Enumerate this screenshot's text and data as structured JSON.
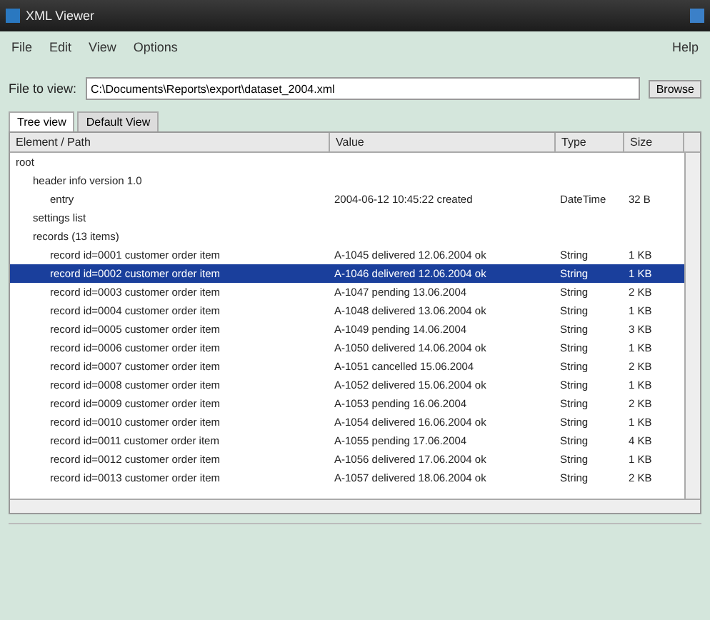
{
  "window": {
    "title": "XML Viewer"
  },
  "menu": [
    {
      "label": "File"
    },
    {
      "label": "Edit"
    },
    {
      "label": "View"
    },
    {
      "label": "Options"
    }
  ],
  "help_menu": {
    "label": "Help"
  },
  "file_row": {
    "label": "File to view:",
    "value": "C:\\Documents\\Reports\\export\\dataset_2004.xml",
    "button": "Browse"
  },
  "tabs": [
    {
      "label": "Tree view",
      "selected": true
    },
    {
      "label": "Default View",
      "selected": false
    }
  ],
  "table": {
    "columns": [
      "Element / Path",
      "Value",
      "Type",
      "Size"
    ],
    "rows": [
      {
        "name": "root",
        "selected": false,
        "children": [
          {
            "name": "header info version 1.0",
            "selected": false,
            "children": [
              {
                "name": "entry",
                "value": "2004-06-12 10:45:22 created",
                "type": "DateTime",
                "size": "32 B",
                "selected": false
              }
            ]
          },
          {
            "name": "settings list",
            "selected": false
          },
          {
            "name": "records (13 items)",
            "selected": false,
            "children": [
              {
                "name": "record id=0001 customer order item",
                "value": "A-1045 delivered 12.06.2004 ok",
                "type": "String",
                "size": "1 KB",
                "selected": false
              },
              {
                "name": "record id=0002 customer order item",
                "value": "A-1046 delivered 12.06.2004 ok",
                "type": "String",
                "size": "1 KB",
                "selected": true
              },
              {
                "name": "record id=0003 customer order item",
                "value": "A-1047 pending 13.06.2004",
                "type": "String",
                "size": "2 KB",
                "selected": false
              },
              {
                "name": "record id=0004 customer order item",
                "value": "A-1048 delivered 13.06.2004 ok",
                "type": "String",
                "size": "1 KB",
                "selected": false
              },
              {
                "name": "record id=0005 customer order item",
                "value": "A-1049 pending 14.06.2004",
                "type": "String",
                "size": "3 KB",
                "selected": false
              },
              {
                "name": "record id=0006 customer order item",
                "value": "A-1050 delivered 14.06.2004 ok",
                "type": "String",
                "size": "1 KB",
                "selected": false
              },
              {
                "name": "record id=0007 customer order item",
                "value": "A-1051 cancelled 15.06.2004",
                "type": "String",
                "size": "2 KB",
                "selected": false
              },
              {
                "name": "record id=0008 customer order item",
                "value": "A-1052 delivered 15.06.2004 ok",
                "type": "String",
                "size": "1 KB",
                "selected": false
              },
              {
                "name": "record id=0009 customer order item",
                "value": "A-1053 pending 16.06.2004",
                "type": "String",
                "size": "2 KB",
                "selected": false
              },
              {
                "name": "record id=0010 customer order item",
                "value": "A-1054 delivered 16.06.2004 ok",
                "type": "String",
                "size": "1 KB",
                "selected": false
              },
              {
                "name": "record id=0011 customer order item",
                "value": "A-1055 pending 17.06.2004",
                "type": "String",
                "size": "4 KB",
                "selected": false
              },
              {
                "name": "record id=0012 customer order item",
                "value": "A-1056 delivered 17.06.2004 ok",
                "type": "String",
                "size": "1 KB",
                "selected": false
              },
              {
                "name": "record id=0013 customer order item",
                "value": "A-1057 delivered 18.06.2004 ok",
                "type": "String",
                "size": "2 KB",
                "selected": false
              }
            ]
          }
        ]
      }
    ]
  }
}
